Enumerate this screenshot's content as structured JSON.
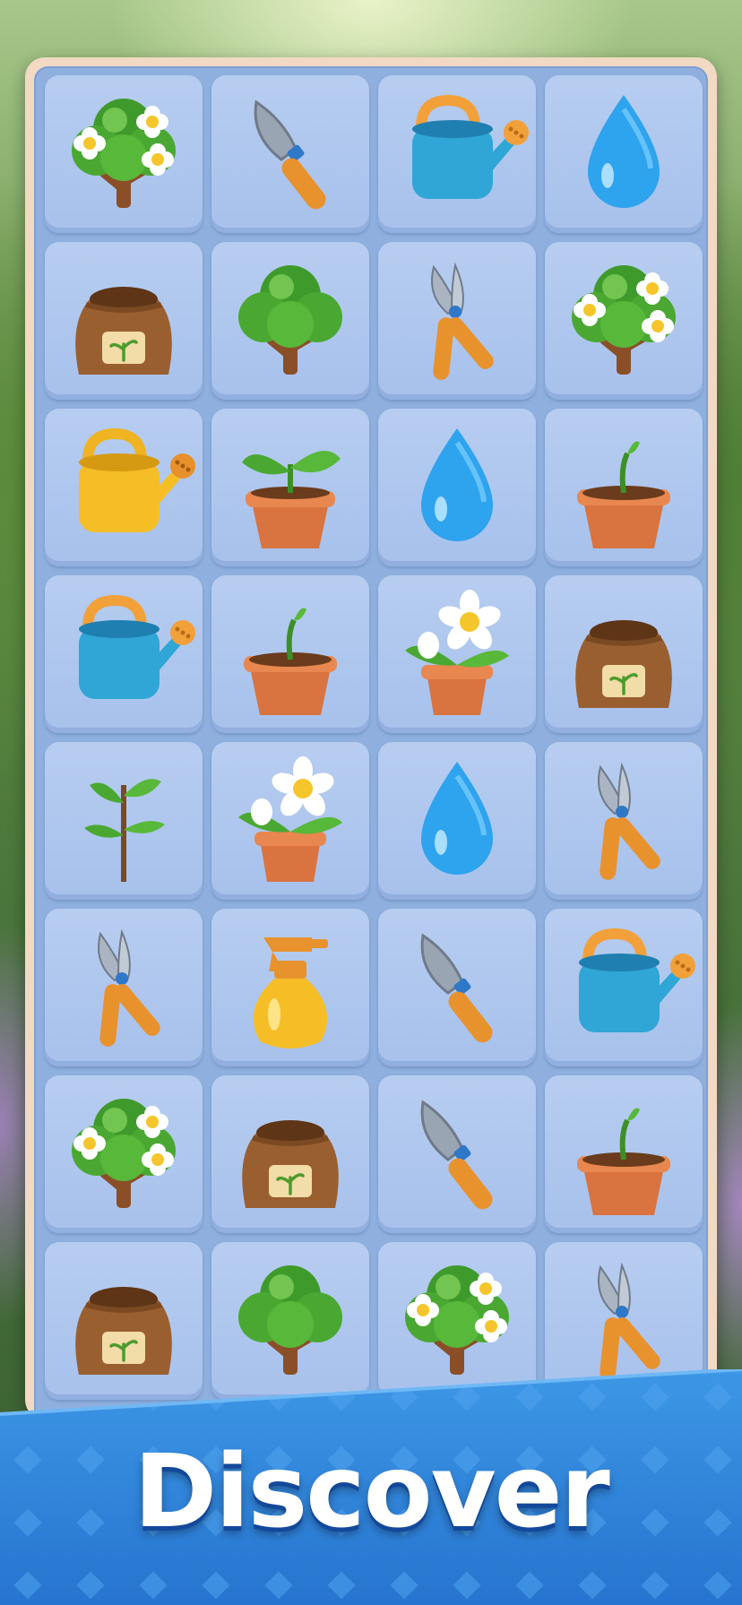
{
  "banner": {
    "title": "Discover"
  },
  "colors": {
    "tile": "#a7c1ec",
    "board_frame": "#f2d9c4",
    "banner_blue": "#2f86dc",
    "banner_title": "#ffffff"
  },
  "board": {
    "columns": 4,
    "rows": [
      [
        "flowering-tree",
        "trowel",
        "blue-watering-can",
        "water-drop"
      ],
      [
        "soil-sack",
        "green-tree",
        "pruning-shears",
        "flowering-tree"
      ],
      [
        "yellow-watering-can",
        "potted-plant",
        "water-drop",
        "sprout-pot"
      ],
      [
        "blue-watering-can",
        "sprout-pot",
        "potted-daisy",
        "soil-sack"
      ],
      [
        "sapling",
        "potted-daisy",
        "water-drop",
        "pruning-shears"
      ],
      [
        "pruning-shears",
        "spray-bottle",
        "trowel",
        "blue-watering-can"
      ],
      [
        "flowering-tree",
        "soil-sack",
        "trowel",
        "sprout-pot"
      ],
      [
        "soil-sack",
        "green-tree",
        "flowering-tree",
        "pruning-shears"
      ]
    ]
  }
}
